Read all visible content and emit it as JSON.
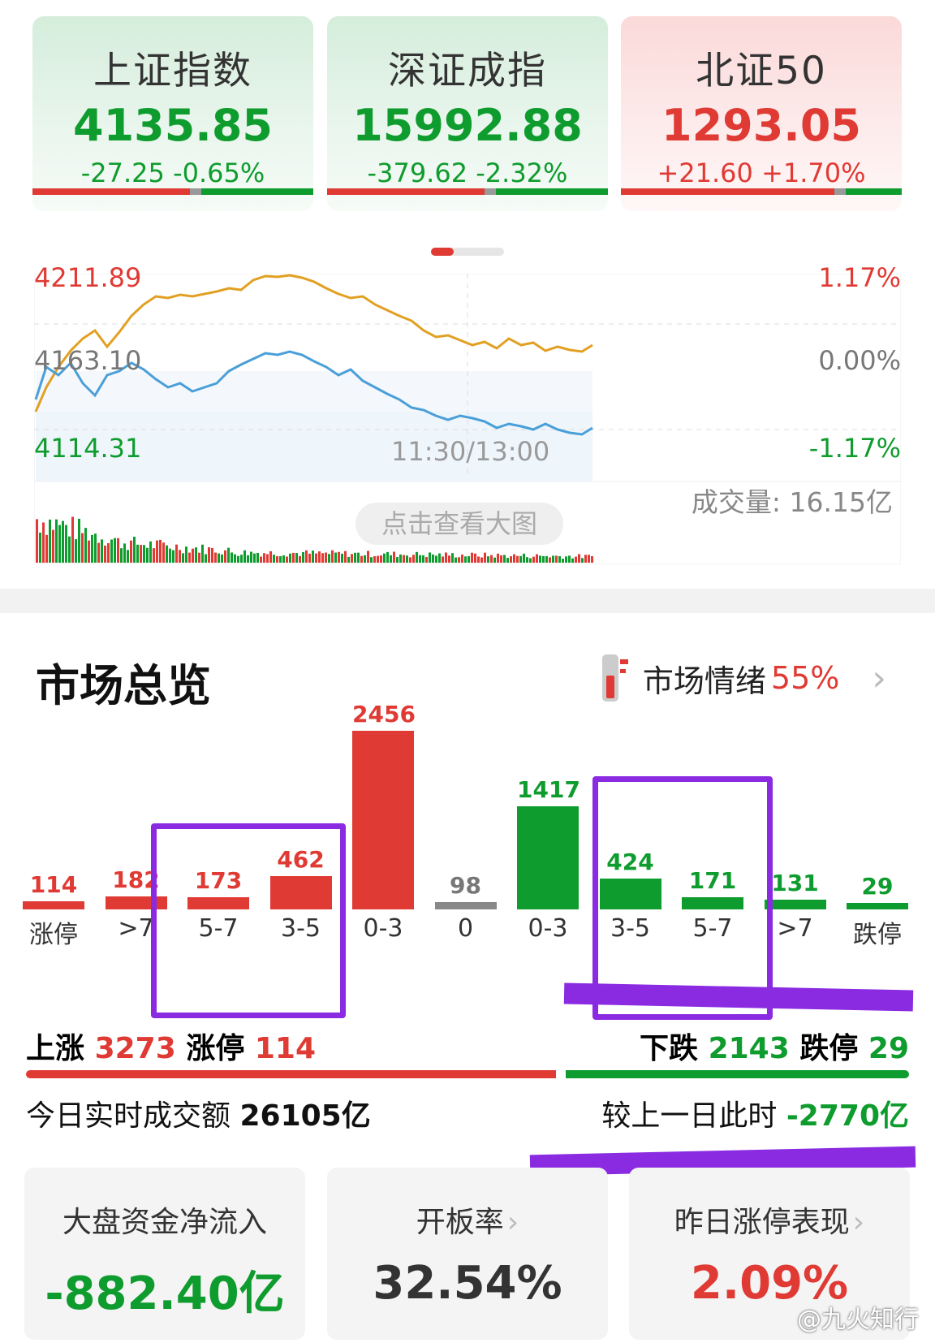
{
  "indices": [
    {
      "name": "上证指数",
      "value": "4135.85",
      "change": "-27.25  -0.65%",
      "color": "#0f9c2e"
    },
    {
      "name": "深证成指",
      "value": "15992.88",
      "change": "-379.62  -2.32%",
      "color": "#0f9c2e"
    },
    {
      "name": "北证50",
      "value": "1293.05",
      "change": "+21.60  +1.70%",
      "color": "#e03a34"
    }
  ],
  "chart": {
    "y_high": "4211.89",
    "y_mid": "4163.10",
    "y_low": "4114.31",
    "pct_high": "1.17%",
    "pct_mid": "0.00%",
    "pct_low": "-1.17%",
    "time_label": "11:30/13:00",
    "volume_label": "成交量: 16.15亿",
    "view_button": "点击查看大图"
  },
  "overview": {
    "title": "市场总览",
    "mood_label": "市场情绪",
    "mood_value": "55%",
    "distribution": [
      {
        "label": "涨停",
        "value": 114,
        "color": "#e03a34"
      },
      {
        "label": ">7",
        "value": 182,
        "color": "#e03a34"
      },
      {
        "label": "5-7",
        "value": 173,
        "color": "#e03a34"
      },
      {
        "label": "3-5",
        "value": 462,
        "color": "#e03a34"
      },
      {
        "label": "0-3",
        "value": 2456,
        "color": "#e03a34"
      },
      {
        "label": "0",
        "value": 98,
        "color": "#888888"
      },
      {
        "label": "0-3",
        "value": 1417,
        "color": "#0f9c2e"
      },
      {
        "label": "3-5",
        "value": 424,
        "color": "#0f9c2e"
      },
      {
        "label": "5-7",
        "value": 171,
        "color": "#0f9c2e"
      },
      {
        "label": ">7",
        "value": 131,
        "color": "#0f9c2e"
      },
      {
        "label": "跌停",
        "value": 29,
        "color": "#0f9c2e"
      }
    ],
    "up_label": "上涨",
    "up_value": "3273",
    "limit_up_label": "涨停",
    "limit_up_value": "114",
    "down_label": "下跌",
    "down_value": "2143",
    "limit_down_label": "跌停",
    "limit_down_value": "29",
    "turnover_label": "今日实时成交额",
    "turnover_value": "26105亿",
    "compare_label": "较上一日此时",
    "compare_value": "-2770亿"
  },
  "tiles": [
    {
      "title": "大盘资金净流入",
      "value": "-882.40亿",
      "color": "#0f9c2e"
    },
    {
      "title": "开板率",
      "value": "32.54%",
      "color": "#333333"
    },
    {
      "title": "昨日涨停表现",
      "value": "2.09%",
      "color": "#e03a34"
    }
  ],
  "watermark": "@九火知行"
}
